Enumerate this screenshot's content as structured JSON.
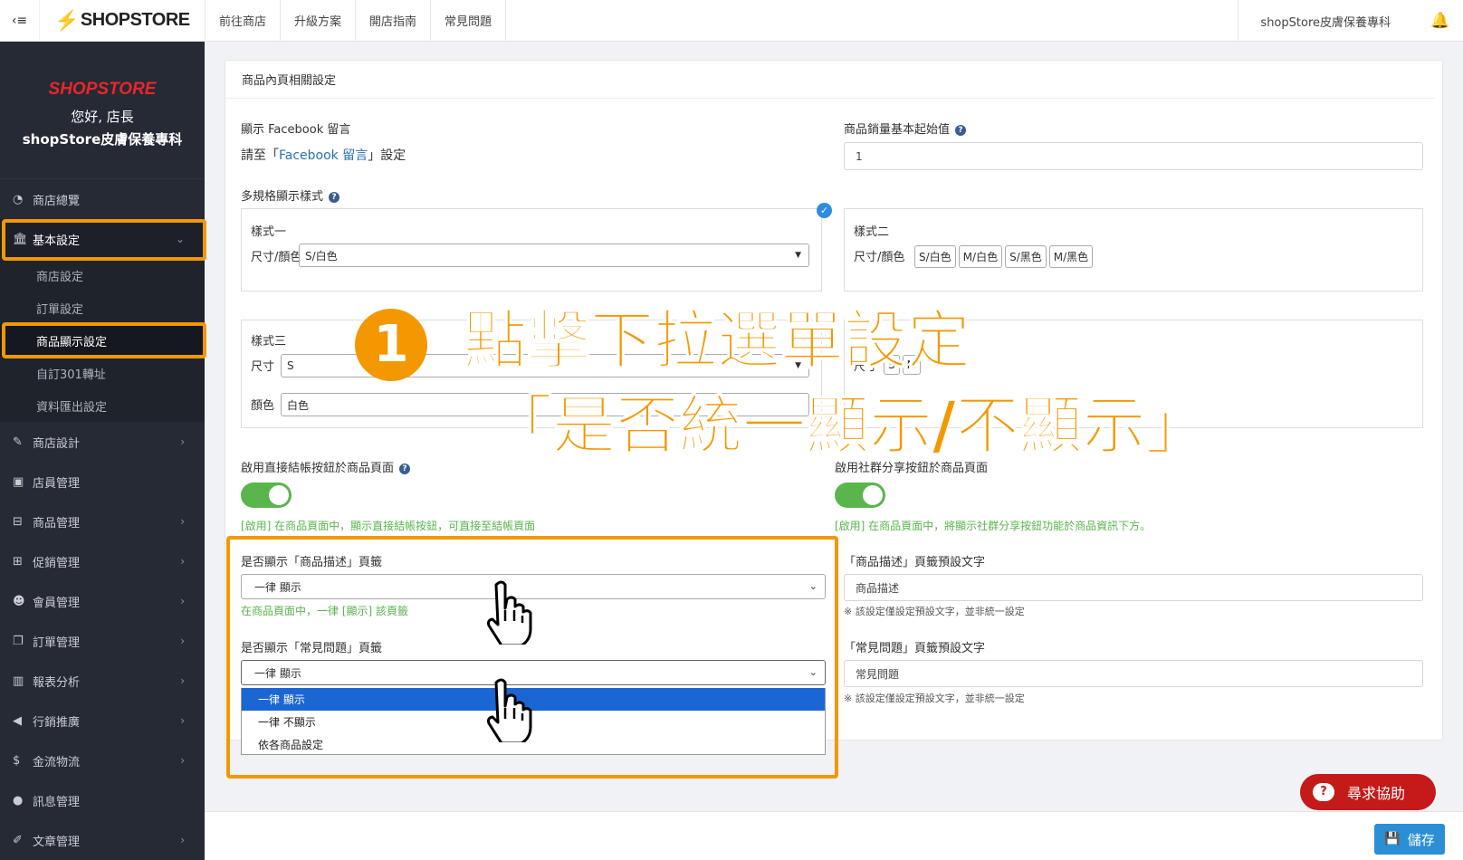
{
  "topbar": {
    "logo_text": "SHOPSTORE",
    "nav": [
      "前往商店",
      "升級方案",
      "開店指南",
      "常見問題"
    ],
    "store_name": "shopStore皮膚保養專科"
  },
  "sidebar": {
    "logo": "SHOPSTORE",
    "greeting": "您好, 店長",
    "store": "shopStore皮膚保養專科",
    "items": [
      {
        "label": "商店總覽",
        "icon": "dashboard-icon"
      },
      {
        "label": "基本設定",
        "icon": "bank-icon"
      },
      {
        "label": "商店設計",
        "icon": "magic-icon"
      },
      {
        "label": "店員管理",
        "icon": "staff-icon"
      },
      {
        "label": "商品管理",
        "icon": "cart-icon"
      },
      {
        "label": "促銷管理",
        "icon": "gift-icon"
      },
      {
        "label": "會員管理",
        "icon": "users-icon"
      },
      {
        "label": "訂單管理",
        "icon": "copy-icon"
      },
      {
        "label": "報表分析",
        "icon": "bar-chart-icon"
      },
      {
        "label": "行銷推廣",
        "icon": "bullhorn-icon"
      },
      {
        "label": "金流物流",
        "icon": "dollar-icon"
      },
      {
        "label": "訊息管理",
        "icon": "chat-icon"
      },
      {
        "label": "文章管理",
        "icon": "edit-icon"
      }
    ],
    "subitems": [
      "商店設定",
      "訂單設定",
      "商品顯示設定",
      "自訂301轉址",
      "資料匯出設定"
    ]
  },
  "card": {
    "title": "商品內頁相關設定",
    "fb_label": "顯示 Facebook 留言",
    "fb_hint_pre": "請至「",
    "fb_hint_link": "Facebook 留言",
    "fb_hint_post": "」設定",
    "sales_label": "商品銷量基本起始值",
    "sales_value": "1",
    "multi_label": "多規格顯示樣式",
    "style1": {
      "name": "樣式一",
      "row_label": "尺寸/顏色",
      "select": "S/白色"
    },
    "style2": {
      "name": "樣式二",
      "row_label": "尺寸/顏色",
      "tags": [
        "S/白色",
        "M/白色",
        "S/黑色",
        "M/黑色"
      ]
    },
    "style3": {
      "name": "樣式三",
      "size_label": "尺寸",
      "size_value": "S",
      "color_label": "顏色",
      "color_value": "白色"
    },
    "style4": {
      "size_label": "尺寸",
      "tags": [
        "S",
        "M"
      ]
    },
    "checkout_label": "啟用直接結帳按鈕於商品頁面",
    "checkout_hint": "[啟用] 在商品頁面中，顯示直接結帳按鈕，可直接至結帳頁面",
    "share_label": "啟用社群分享按鈕於商品頁面",
    "share_hint": "[啟用] 在商品頁面中，將顯示社群分享按鈕功能於商品資訊下方。",
    "desc_show_label": "是否顯示「商品描述」頁籤",
    "desc_show_value": "一律 顯示",
    "desc_show_hint": "在商品頁面中，一律 [顯示] 該頁籤",
    "faq_show_label": "是否顯示「常見問題」頁籤",
    "faq_show_value": "一律 顯示",
    "faq_options": [
      "一律 顯示",
      "一律 不顯示",
      "依各商品設定"
    ],
    "desc_default_label": "「商品描述」頁籤預設文字",
    "desc_default_value": "商品描述",
    "desc_default_note": "※ 該設定僅設定預設文字，並非統一設定",
    "faq_default_label": "「常見問題」頁籤預設文字",
    "faq_default_value": "常見問題",
    "faq_default_note": "※ 該設定僅設定預設文字，並非統一設定"
  },
  "overlay": {
    "step": "1",
    "line1": "點擊下拉選單設定",
    "line2": "「是否統一顯示/不顯示」"
  },
  "buttons": {
    "help": "尋求協助",
    "save": "儲存"
  },
  "colors": {
    "accent": "#f39800",
    "sidebar_bg": "#252a34",
    "toggle_on": "#5ab54d",
    "option_selected": "#1a66d2",
    "help_btn": "#c41a1a",
    "save_btn": "#2a8fd4"
  }
}
